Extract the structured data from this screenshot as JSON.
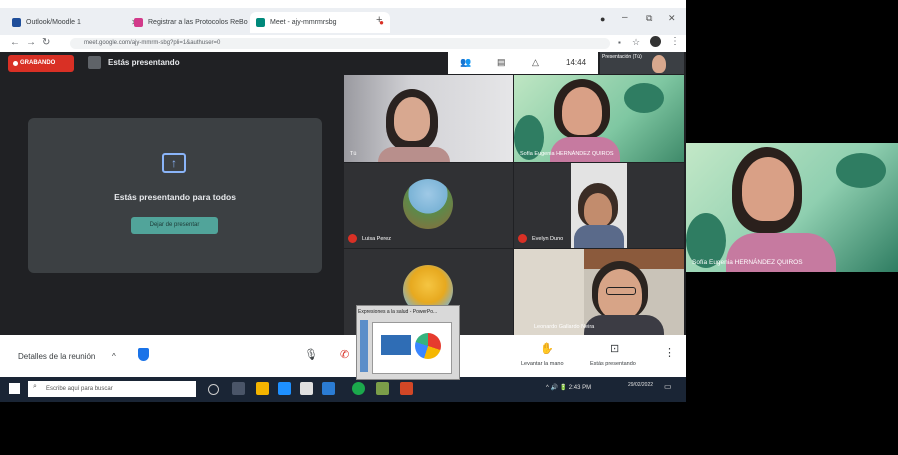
{
  "browser": {
    "tabs": [
      {
        "label": "Outlook/Moodle 1"
      },
      {
        "label": "Registrar a las Protocolos ReBo"
      },
      {
        "label": "Meet - ajy-mmrmrsbg"
      }
    ],
    "url": "meet.google.com/ajy-mmrm-sbg?pli=1&authuser=0"
  },
  "meet": {
    "recording_label": "GRABANDO",
    "presenting_status": "Estás presentando",
    "presenting_card_text": "Estás presentando para todos",
    "stop_button": "Dejar de presentar",
    "clock": "14:44",
    "self_thumb_label": "Presentación (Tú)"
  },
  "participants": [
    {
      "name": "Tú"
    },
    {
      "name": "Sofía Eugenia HERNÁNDEZ QUIROS"
    },
    {
      "name": "Luisa Perez"
    },
    {
      "name": "Evelyn Duno"
    },
    {
      "name": "Leonardo Gallardo Neira"
    }
  ],
  "bottom_bar": {
    "details": "Detalles de la reunión",
    "raise_hand": "Levantar la mano",
    "present_now": "Estás presentando"
  },
  "taskbar": {
    "search_placeholder": "Escribe aquí para buscar",
    "tray_time": "2:43 PM",
    "tray_date": "29/02/2022"
  },
  "popup": {
    "title": "Expresiones a la salud - PowerPo..."
  },
  "self_view": {
    "name": "Sofía Eugenia HERNÁNDEZ QUIROS"
  }
}
